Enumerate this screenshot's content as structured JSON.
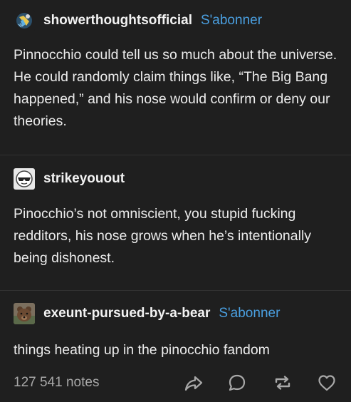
{
  "posts": [
    {
      "username": "showerthoughtsofficial",
      "follow_label": "S'abonner",
      "text": "Pinnocchio could tell us so much about the universe. He could randomly claim things like, “The Big Bang happened,” and his nose would confirm or deny our theories."
    },
    {
      "username": "strikeyouout",
      "text": "Pinocchio’s not omniscient, you stupid fucking redditors, his nose grows when he’s intentionally being dishonest."
    },
    {
      "username": "exeunt-pursued-by-a-bear",
      "follow_label": "S'abonner",
      "text": "things heating up in the pinocchio fandom"
    }
  ],
  "footer": {
    "notes": "127 541 notes",
    "icons": [
      "share-icon",
      "reply-icon",
      "reblog-icon",
      "like-icon"
    ]
  },
  "colors": {
    "background": "#1f1f1f",
    "text": "#ececec",
    "follow": "#4a9fe0",
    "muted": "#a8a8a8",
    "divider": "#323232"
  }
}
